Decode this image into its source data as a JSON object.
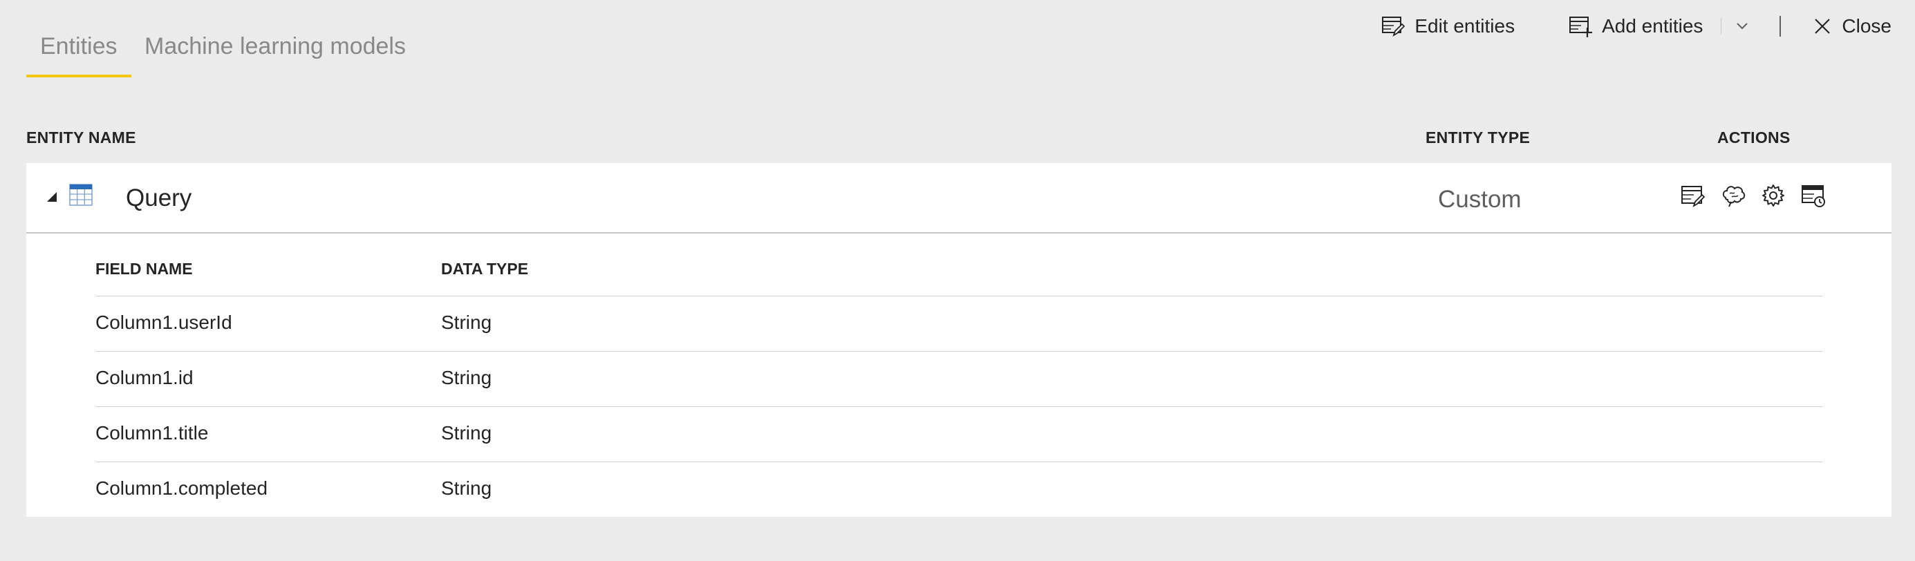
{
  "tabs": [
    {
      "label": "Entities",
      "active": true
    },
    {
      "label": "Machine learning models",
      "active": false
    }
  ],
  "toolbar": {
    "edit_label": "Edit entities",
    "add_label": "Add entities",
    "close_label": "Close"
  },
  "columns": {
    "entity_name": "ENTITY NAME",
    "entity_type": "ENTITY TYPE",
    "actions": "ACTIONS"
  },
  "entity": {
    "name": "Query",
    "type": "Custom",
    "expanded": true,
    "action_icons": [
      "edit-entity-icon",
      "ai-insights-icon",
      "settings-icon",
      "incremental-refresh-icon"
    ]
  },
  "fields_table": {
    "headers": {
      "field_name": "FIELD NAME",
      "data_type": "DATA TYPE"
    },
    "rows": [
      {
        "field": "Column1.userId",
        "type": "String"
      },
      {
        "field": "Column1.id",
        "type": "String"
      },
      {
        "field": "Column1.title",
        "type": "String"
      },
      {
        "field": "Column1.completed",
        "type": "String"
      }
    ]
  },
  "colors": {
    "background": "#ebebeb",
    "panel": "#ffffff",
    "tab_underline": "#f2c811",
    "text": "#252423",
    "muted_text": "#8a8886"
  }
}
